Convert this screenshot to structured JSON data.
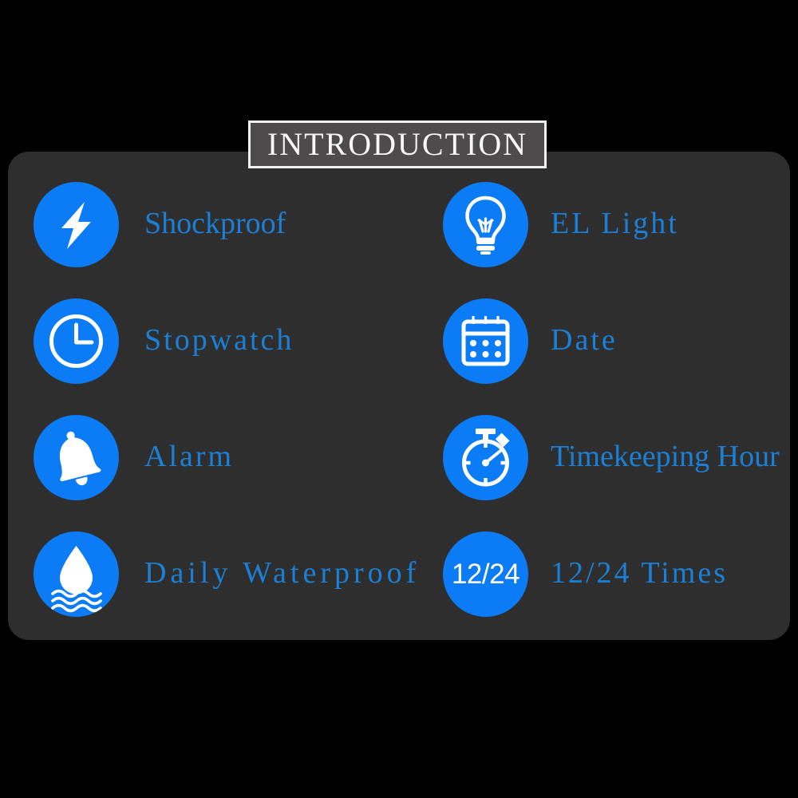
{
  "page": {
    "background_color": "#000000",
    "panel_color": "#2e2e2e",
    "accent_blue": "#0b7cf5",
    "label_blue": "#1c7fd6",
    "title_box_color": "#4d4b4b",
    "title_border_color": "#f2f2f2",
    "title_text_color": "#f7f7f7"
  },
  "header": {
    "title": "INTRODUCTION"
  },
  "features": [
    {
      "id": "shockproof",
      "label": "Shockproof",
      "icon": "lightning-bolt-icon",
      "column": 1,
      "row": 1
    },
    {
      "id": "el-light",
      "label": "EL Light",
      "icon": "light-bulb-icon",
      "column": 2,
      "row": 1
    },
    {
      "id": "stopwatch",
      "label": "Stopwatch",
      "icon": "clock-icon",
      "column": 1,
      "row": 2
    },
    {
      "id": "date",
      "label": "Date",
      "icon": "calendar-icon",
      "column": 2,
      "row": 2
    },
    {
      "id": "alarm",
      "label": "Alarm",
      "icon": "bell-icon",
      "column": 1,
      "row": 3
    },
    {
      "id": "timekeeping-hour",
      "label": "Timekeeping Hour",
      "icon": "stopwatch-icon",
      "column": 2,
      "row": 3
    },
    {
      "id": "daily-waterproof",
      "label": "Daily Waterproof",
      "icon": "water-drop-icon",
      "column": 1,
      "row": 4
    },
    {
      "id": "twelve-twentyfour-times",
      "label": "12/24 Times",
      "icon": "12-24-text-icon",
      "icon_text": "12/24",
      "column": 2,
      "row": 4
    }
  ]
}
